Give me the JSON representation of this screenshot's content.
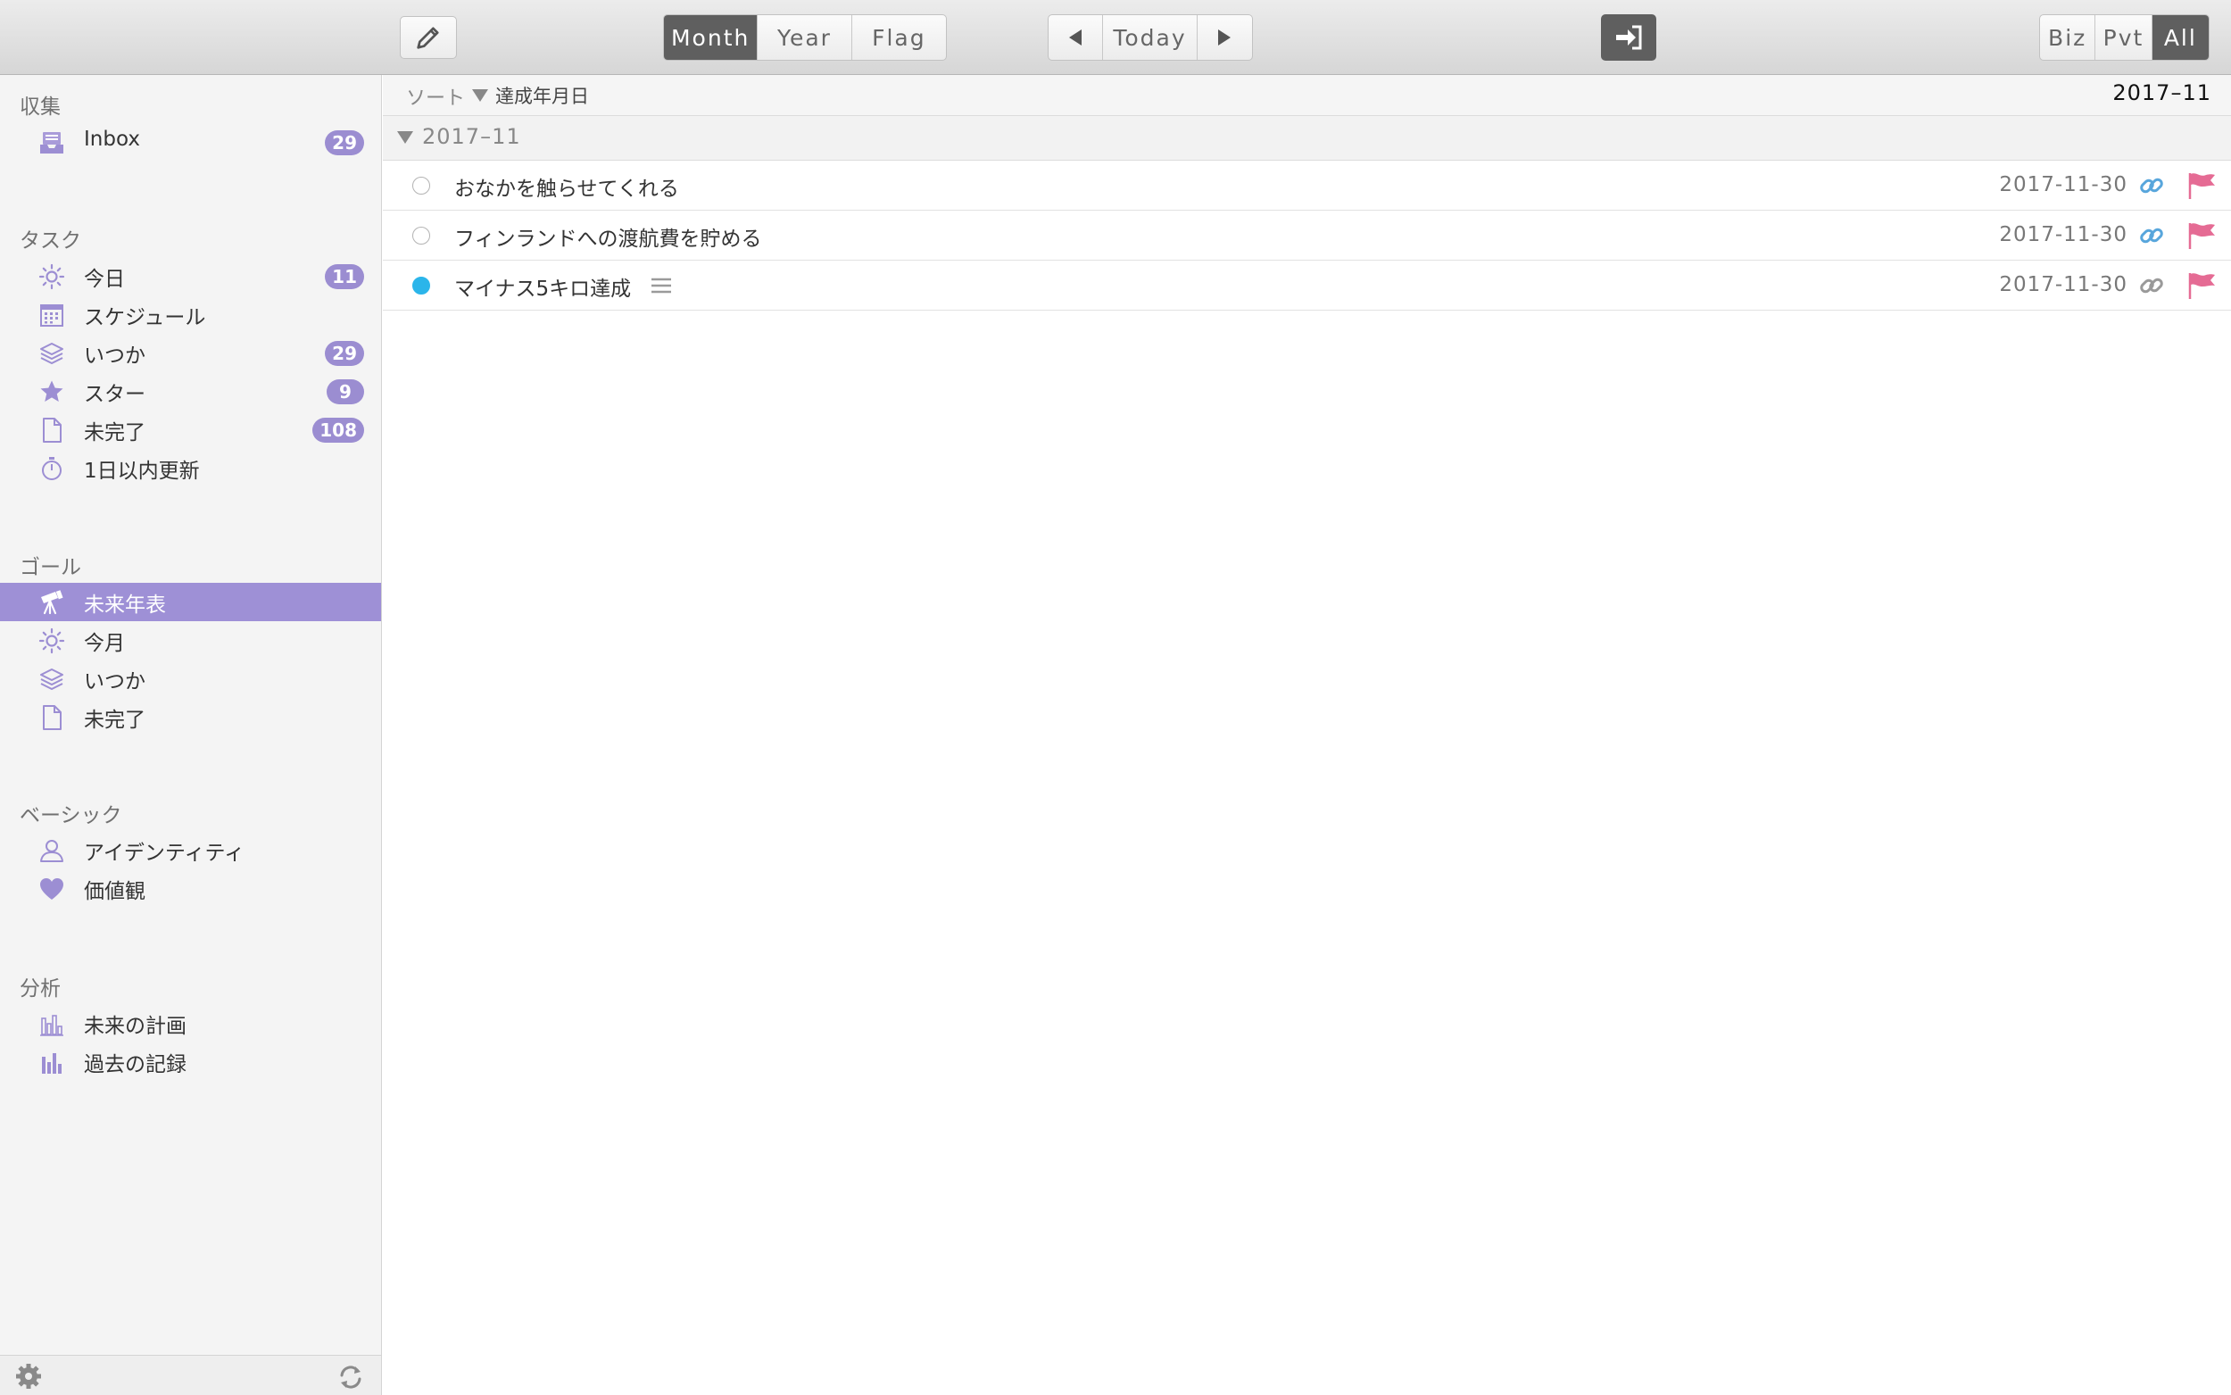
{
  "toolbar": {
    "view_tabs": [
      {
        "label": "Month",
        "active": true
      },
      {
        "label": "Year",
        "active": false
      },
      {
        "label": "Flag",
        "active": false
      }
    ],
    "today_label": "Today",
    "filter_tabs": [
      {
        "label": "Biz",
        "active": false
      },
      {
        "label": "Pvt",
        "active": false
      },
      {
        "label": "All",
        "active": true
      }
    ]
  },
  "sidebar": {
    "collect": {
      "title": "収集",
      "items": [
        {
          "label": "Inbox",
          "badge": "29",
          "icon": "inbox-icon"
        }
      ]
    },
    "tasks": {
      "title": "タスク",
      "items": [
        {
          "label": "今日",
          "badge": "11",
          "icon": "sun-icon"
        },
        {
          "label": "スケジュール",
          "badge": "",
          "icon": "calendar-icon"
        },
        {
          "label": "いつか",
          "badge": "29",
          "icon": "layers-icon"
        },
        {
          "label": "スター",
          "badge": "9",
          "icon": "star-icon"
        },
        {
          "label": "未完了",
          "badge": "108",
          "icon": "document-icon"
        },
        {
          "label": "1日以内更新",
          "badge": "",
          "icon": "stopwatch-icon"
        }
      ]
    },
    "goals": {
      "title": "ゴール",
      "items": [
        {
          "label": "未来年表",
          "active": true,
          "icon": "telescope-icon"
        },
        {
          "label": "今月",
          "icon": "sun-icon"
        },
        {
          "label": "いつか",
          "icon": "layers-icon"
        },
        {
          "label": "未完了",
          "icon": "document-icon"
        }
      ]
    },
    "basic": {
      "title": "ベーシック",
      "items": [
        {
          "label": "アイデンティティ",
          "icon": "person-icon"
        },
        {
          "label": "価値観",
          "icon": "heart-icon"
        }
      ]
    },
    "analysis": {
      "title": "分析",
      "items": [
        {
          "label": "未来の計画",
          "icon": "bar-chart-outline-icon"
        },
        {
          "label": "過去の記録",
          "icon": "bar-chart-icon"
        }
      ]
    }
  },
  "main": {
    "sort_label": "ソート",
    "sort_value": "達成年月日",
    "period": "2017–11",
    "group": {
      "label": "2017–11"
    },
    "goals": [
      {
        "title": "おなかを触らせてくれる",
        "date": "2017-11-30",
        "done": false,
        "linked": true,
        "note": false
      },
      {
        "title": "フィンランドへの渡航費を貯める",
        "date": "2017-11-30",
        "done": false,
        "linked": true,
        "note": false
      },
      {
        "title": "マイナス5キロ達成",
        "date": "2017-11-30",
        "done": true,
        "linked": false,
        "note": true
      }
    ]
  },
  "colors": {
    "accent": "#9e90d6",
    "badge": "#9b8dd1",
    "done_dot": "#2bb5ea",
    "flag": "#e56b94",
    "link_active": "#58a6dc",
    "link_inactive": "#9a9a9a"
  }
}
